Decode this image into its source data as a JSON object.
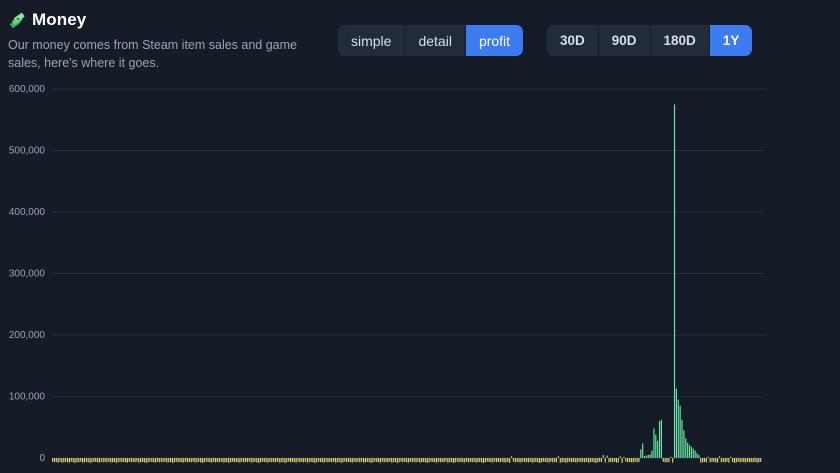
{
  "header": {
    "icon": "money-stack-icon",
    "title": "Money",
    "subtitle": "Our money comes from Steam item sales and game sales, here's where it goes."
  },
  "view_modes": {
    "options": [
      "simple",
      "detail",
      "profit"
    ],
    "selected": "profit"
  },
  "time_ranges": {
    "options": [
      "30D",
      "90D",
      "180D",
      "1Y"
    ],
    "selected": "1Y"
  },
  "colors": {
    "background": "#151c28",
    "accent": "#3d7bf0",
    "positive_bar": "#6ee7a6",
    "negative_bar": "#e6d36a",
    "grid": "#22303b"
  },
  "chart_data": {
    "type": "bar",
    "title": "",
    "xlabel": "",
    "ylabel": "",
    "ylim": [
      0,
      600000
    ],
    "y_ticks": [
      "600,000",
      "500,000",
      "400,000",
      "300,000",
      "200,000",
      "100,000",
      "0"
    ],
    "y_tick_values": [
      600000,
      500000,
      400000,
      300000,
      200000,
      100000,
      0
    ],
    "grid": true,
    "legend": "none",
    "series": [
      {
        "values": [
          -6000,
          -7000,
          -6500,
          -7500,
          -6000,
          -8000,
          -7000,
          -6500,
          -7000,
          -7500,
          -6000,
          -7000,
          -8000,
          -6500,
          -7000,
          -6000,
          -7500,
          -7000,
          -6500,
          -7000,
          -8000,
          -7000,
          -6000,
          -6500,
          -7000,
          -7500,
          -6000,
          -7000,
          -6500,
          -7000,
          -6000,
          -7500,
          -7000,
          -6500,
          -8000,
          -7000,
          -6000,
          -7000,
          -6500,
          -7000,
          -7500,
          -6000,
          -7000,
          -6500,
          -7000,
          -6000,
          -7500,
          -7000,
          -6500,
          -7000,
          -8000,
          -7000,
          -6000,
          -6500,
          -7000,
          -7500,
          -6000,
          -7000,
          -6500,
          -7000,
          -6000,
          -7500,
          -7000,
          -6500,
          -8000,
          -7000,
          -6000,
          -7000,
          -6500,
          -7000,
          -7500,
          -6000,
          -7000,
          -6500,
          -7000,
          -6000,
          -7500,
          -7000,
          -6500,
          -7000,
          -8000,
          -7000,
          -6000,
          -6500,
          -7000,
          -7500,
          -6000,
          -7000,
          -6500,
          -7000,
          -6000,
          -7500,
          -7000,
          -6500,
          -8000,
          -7000,
          -6000,
          -7000,
          -6500,
          -7000,
          -7500,
          -6000,
          -7000,
          -6500,
          -7000,
          -6000,
          -7500,
          -7000,
          -6500,
          -7000,
          -8000,
          -7000,
          -6000,
          -6500,
          -7000,
          -7500,
          -6000,
          -7000,
          -6500,
          -7000,
          -6000,
          -7500,
          -7000,
          -6500,
          -8000,
          -7000,
          -6000,
          -7000,
          -6500,
          -7000,
          -7500,
          -6000,
          -7000,
          -6500,
          -7000,
          -6000,
          -7500,
          -7000,
          -6500,
          -7000,
          -8000,
          -7000,
          -6000,
          -6500,
          -7000,
          -7500,
          -6000,
          -7000,
          -6500,
          -7000,
          -6000,
          -7500,
          -7000,
          -6500,
          -8000,
          -7000,
          -6000,
          -7000,
          -6500,
          -7000,
          -7500,
          -6000,
          -7000,
          -6500,
          -7000,
          -6000,
          -7500,
          -7000,
          -6500,
          -7000,
          -8000,
          -7000,
          -6000,
          -6500,
          -7000,
          -7500,
          -6000,
          -7000,
          -6500,
          -7000,
          -6000,
          -7500,
          -7000,
          -6500,
          -8000,
          -7000,
          -6000,
          -7000,
          -6500,
          -7000,
          -7500,
          -6000,
          -7000,
          -6500,
          -7000,
          -6000,
          -7500,
          -7000,
          -6500,
          -7000,
          -8000,
          -7000,
          -6000,
          -6500,
          -7000,
          -7500,
          -6000,
          -7000,
          -6500,
          -7000,
          -6000,
          -7500,
          -7000,
          -6500,
          -8000,
          -7000,
          -6000,
          -7000,
          -6500,
          -7000,
          -7500,
          -6000,
          -7000,
          -6500,
          -7000,
          -6000,
          -7500,
          -7000,
          -6500,
          -7000,
          -8000,
          -7000,
          -6000,
          -6500,
          -7000,
          -7500,
          -6000,
          -7000,
          -6500,
          -7000,
          -6000,
          -7500,
          -7000,
          -6500,
          -8000,
          -7000,
          -6000,
          -7000,
          -6500,
          -7000,
          -7500,
          -6000,
          -7000,
          -6500,
          -7000,
          -6000,
          -7500,
          -7000,
          -6500,
          -7000,
          -8000,
          -7000,
          -6000,
          -6500,
          -7000,
          -7500,
          -6000,
          -7000,
          -6500,
          -7000,
          -6000,
          -7500,
          -7000,
          -6500,
          -8000,
          -7000,
          -6000,
          -7000,
          -6500,
          -7000,
          -7500,
          -6000,
          -7000,
          -6500,
          -7000,
          -6000,
          -7500,
          -7000,
          -6500,
          -7000,
          -8000,
          -7000,
          -6000,
          -6500,
          -7000,
          -7500,
          -6000,
          -7000,
          -6500,
          -7000,
          -6000,
          -7500,
          -7000,
          -6500,
          -8000,
          -7000,
          -6000,
          -7000,
          -6500,
          -7000,
          -7500,
          -6000,
          -7000,
          -6500,
          -7000,
          -6000,
          -7500,
          -7000,
          -6500,
          -7000,
          -8000,
          -7000,
          -6000,
          -6500,
          -7000,
          -7500,
          -6000,
          -7000,
          -6500,
          -7000,
          -6000,
          -7500,
          -7000,
          -6500,
          -8000,
          -7000,
          -6000,
          -7000,
          -6500,
          -7000,
          -7500,
          -6000,
          -7000,
          -6500,
          -7000,
          -6000,
          -7500,
          -7000,
          -6500,
          -7000,
          -8000,
          -7000,
          -6000,
          -6500,
          -7000,
          -7500,
          -6000,
          -7000,
          -6500,
          -7000,
          -6000,
          -7500,
          -7000,
          -6500,
          -8000,
          -7000,
          -6000,
          -7000,
          -6500,
          -7000,
          -7500,
          -6000,
          -7000,
          -6500,
          -7000,
          -6000,
          -7500,
          -7000,
          -6500
        ],
        "spikes": [
          {
            "index": 245,
            "value": 3000
          },
          {
            "index": 305,
            "value": 2000
          },
          {
            "index": 270,
            "value": 3000
          },
          {
            "index": 294,
            "value": 5000
          },
          {
            "index": 296,
            "value": 4000
          },
          {
            "index": 303,
            "value": 3000
          },
          {
            "index": 314,
            "value": 14000
          },
          {
            "index": 315,
            "value": 24000
          },
          {
            "index": 316,
            "value": 3000
          },
          {
            "index": 317,
            "value": 4000
          },
          {
            "index": 318,
            "value": 5000
          },
          {
            "index": 319,
            "value": 6000
          },
          {
            "index": 320,
            "value": 12000
          },
          {
            "index": 321,
            "value": 48000
          },
          {
            "index": 322,
            "value": 38000
          },
          {
            "index": 323,
            "value": 28000
          },
          {
            "index": 324,
            "value": 60000
          },
          {
            "index": 325,
            "value": 62000
          },
          {
            "index": 330,
            "value": 2000
          },
          {
            "index": 332,
            "value": 575000
          },
          {
            "index": 333,
            "value": 113000
          },
          {
            "index": 334,
            "value": 95000
          },
          {
            "index": 335,
            "value": 85000
          },
          {
            "index": 336,
            "value": 62000
          },
          {
            "index": 337,
            "value": 45000
          },
          {
            "index": 338,
            "value": 32000
          },
          {
            "index": 339,
            "value": 25000
          },
          {
            "index": 340,
            "value": 21000
          },
          {
            "index": 341,
            "value": 18000
          },
          {
            "index": 342,
            "value": 15000
          },
          {
            "index": 343,
            "value": 12000
          },
          {
            "index": 344,
            "value": 8000
          },
          {
            "index": 345,
            "value": 5000
          },
          {
            "index": 350,
            "value": 2000
          },
          {
            "index": 356,
            "value": 3000
          },
          {
            "index": 362,
            "value": 2000
          }
        ]
      }
    ]
  }
}
